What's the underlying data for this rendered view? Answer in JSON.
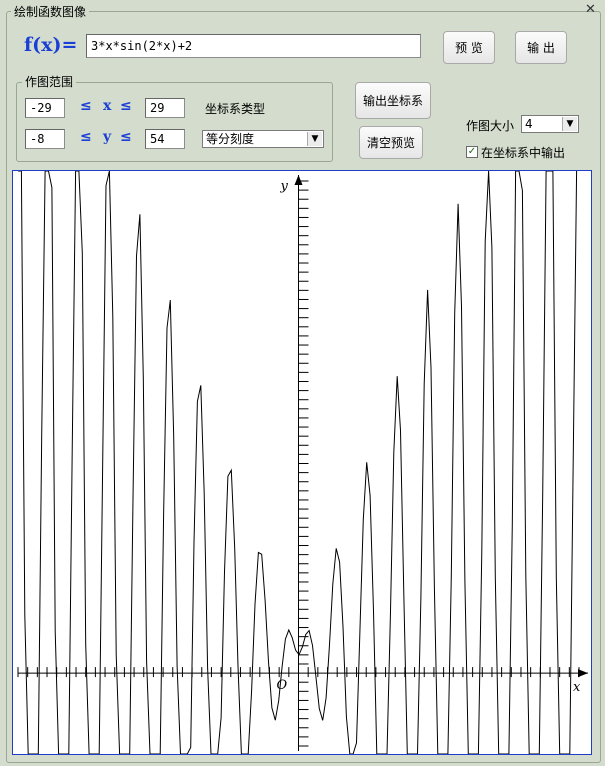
{
  "window": {
    "title": "绘制函数图像",
    "close_glyph": "✕"
  },
  "function": {
    "label": "f(x)=",
    "expression": "3*x*sin(2*x)+2"
  },
  "buttons": {
    "preview": "预 览",
    "output": "输 出",
    "output_axes": "输出坐标系",
    "clear_preview": "清空预览"
  },
  "range": {
    "legend": "作图范围",
    "x_min": "-29",
    "x_max": "29",
    "x_var": "x",
    "y_min": "-8",
    "y_max": "54",
    "y_var": "y",
    "le_symbol": "≤"
  },
  "axis_type": {
    "label": "坐标系类型",
    "selected": "等分刻度"
  },
  "plot_size": {
    "label": "作图大小",
    "selected": "4"
  },
  "output_in_axes": {
    "label": "在坐标系中输出",
    "checked": true
  },
  "colors": {
    "accent_blue": "#1a3fd6",
    "panel_bg": "#d4dccd",
    "plot_border": "#1e3ec8"
  },
  "chart_data": {
    "type": "line",
    "function": "3*x*sin(2*x)+2",
    "xlim": [
      -29,
      29
    ],
    "ylim": [
      -8,
      54
    ],
    "xlabel": "x",
    "ylabel": "y",
    "origin_label": "O",
    "x_step": 0.35
  }
}
